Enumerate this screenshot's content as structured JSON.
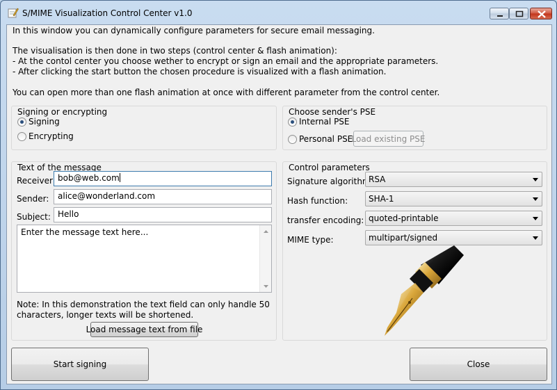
{
  "window": {
    "title": "S/MIME Visualization Control Center v1.0"
  },
  "intro": {
    "line1": "In this window you can dynamically configure parameters for secure email messaging.",
    "line2": "The visualisation is then done in two steps (control center & flash animation):",
    "line3": "- At the contol center you choose wether to encrypt or sign an email and the appropriate parameters.",
    "line4": "- After clicking the start button the chosen procedure is visualized with a flash animation.",
    "line5": "You can open more than one flash animation at once with different parameter from the control center."
  },
  "signing_group": {
    "title": "Signing or encrypting",
    "options": [
      {
        "label": "Signing",
        "selected": true
      },
      {
        "label": "Encrypting",
        "selected": false
      }
    ]
  },
  "pse_group": {
    "title": "Choose sender's PSE",
    "options": [
      {
        "label": "Internal PSE",
        "selected": true
      },
      {
        "label": "Personal PSE",
        "selected": false
      }
    ],
    "load_button": "Load existing PSE"
  },
  "message": {
    "title": "Text of the message",
    "receiver_label": "Receiver:",
    "receiver_value": "bob@web.com",
    "sender_label": "Sender:",
    "sender_value": "alice@wonderland.com",
    "subject_label": "Subject:",
    "subject_value": "Hello",
    "body_text": "Enter the message text here...",
    "note_line1": "Note: In this demonstration the text field can only handle 50",
    "note_line2": "characters, longer texts will be shortened.",
    "load_button": "Load message text from file"
  },
  "control": {
    "title": "Control parameters",
    "fields": [
      {
        "label": "Signature algorithm:",
        "value": "RSA"
      },
      {
        "label": "Hash function:",
        "value": "SHA-1"
      },
      {
        "label": "transfer encoding:",
        "value": "quoted-printable"
      },
      {
        "label": "MIME type:",
        "value": "multipart/signed"
      }
    ]
  },
  "bottom": {
    "start_button": "Start signing",
    "close_button": "Close"
  },
  "icons": {
    "app": "pen-and-paper-icon",
    "illustration": "fountain-pen-icon"
  },
  "colors": {
    "window_frame": "#bcd3ea",
    "client_bg": "#f0f0f0",
    "radio_dot": "#2a4f7d"
  }
}
